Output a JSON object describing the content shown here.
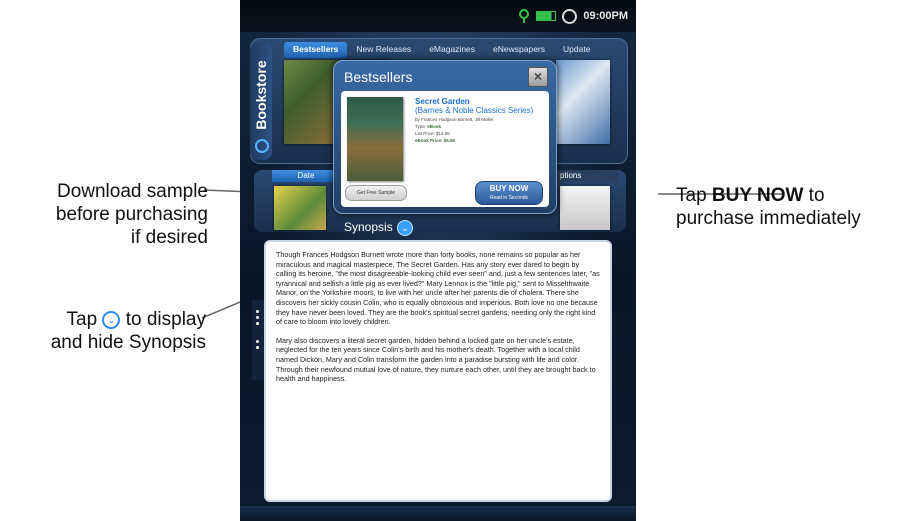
{
  "status_bar": {
    "time": "09:00PM",
    "colors": {
      "battery": "#36c24a",
      "wifi": "#36c24a"
    }
  },
  "side_tab": {
    "label": "Bookstore"
  },
  "tabs": [
    "Bestsellers",
    "New Releases",
    "eMagazines",
    "eNewspapers",
    "Update"
  ],
  "shelf2": {
    "date_tab": "Date",
    "options_tab": "ptions"
  },
  "popup": {
    "title": "Bestsellers",
    "close_icon": "×",
    "book": {
      "title": "Secret Garden",
      "series": "(Barnes & Noble Classics Series)",
      "authors": "by Frances Hodgson Burnett, Jill Muller",
      "type_label": "Type:",
      "type_value": "eBook",
      "list_price": "List Price: $14.95",
      "ebook_price": "eBook Price: $5.50"
    },
    "sample_button": "Get Free Sample",
    "buy_button": {
      "label": "BUY NOW",
      "sub": "Read in Seconds"
    }
  },
  "synopsis": {
    "heading": "Synopsis",
    "paragraphs": [
      "Though Frances Hodgson Burnett wrote more than forty books, none remains so popular as her miraculous and magical masterpiece, The Secret Garden. Has any story ever dared to begin by calling its heroine, \"the most disagreeable-looking child ever seen\" and, just a few sentences later, \"as tyrannical and selfish a little pig as ever lived?\" Mary Lennox is the \"little pig,\" sent to Misselthwaite Manor, on the Yorkshire moors, to live with her uncle after her parents die of cholera. There she discovers her sickly cousin Colin, who is equally obnoxious and imperious. Both love no one because they have never been loved. They are the book's spiritual secret gardens, needing only the right kind of care to bloom into lovely children.",
      "Mary also discovers a literal secret garden, hidden behind a locked gate on her uncle's estate, neglected for the ten years since Colin's birth and his mother's death. Together with a local child named Dickon, Mary and Colin transform the garden into a paradise bursting with life and color. Through their newfound mutual love of nature, they nurture each other, until they are brought back to health and happiness."
    ]
  },
  "callouts": {
    "download": [
      "Download sample",
      "before purchasing",
      "if desired"
    ],
    "buy": {
      "prefix": "Tap ",
      "bold": "BUY NOW",
      "suffix": " to",
      "line2": "purchase immediately"
    },
    "toggle": {
      "prefix": "Tap ",
      "suffix": " to display",
      "line2": "and hide Synopsis"
    }
  },
  "icons": {
    "toggle": "chevron-circle-icon",
    "close": "close-icon"
  },
  "colors": {
    "accent": "#3aa0ff",
    "title_blue": "#1a6fd0"
  }
}
